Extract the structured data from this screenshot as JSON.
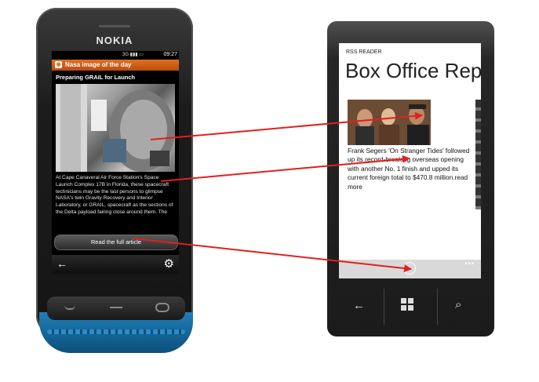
{
  "nokia": {
    "brand": "NOKIA",
    "status_time": "09:27",
    "status_icons": "3G ▮▮▮ ▭",
    "header_title": "Nasa image of the day",
    "rss_icon": "rss-icon",
    "article_title": "Preparing GRAIL for Launch",
    "article_text": "At Cape Canaveral Air Force Station's Space Launch Complex 17B in Florida, these spacecraft technicians may be the last persons to glimpse NASA's twin Gravity Recovery and Interior Laboratory, or GRAIL, spacecraft as the sections of the Delta payload fairing close around them. The",
    "read_full_label": "Read the full article",
    "back_icon": "←",
    "settings_icon": "⚙"
  },
  "windows_phone": {
    "app_label": "RSS READER",
    "panorama_title": "Box Office Rep",
    "article_text": "Frank Segers 'On Stranger Tides' followed up its record-breaking overseas opening with another No. 1 finish and upped its current foreign total to $470.8 million.read more",
    "appbar_icon": "›",
    "more_icon": "•••",
    "back_icon": "←",
    "search_icon": "⌕"
  },
  "colors": {
    "arrow": "#e02020",
    "nokia_header": "#e07020",
    "nokia_base": "#1e7fb8"
  }
}
